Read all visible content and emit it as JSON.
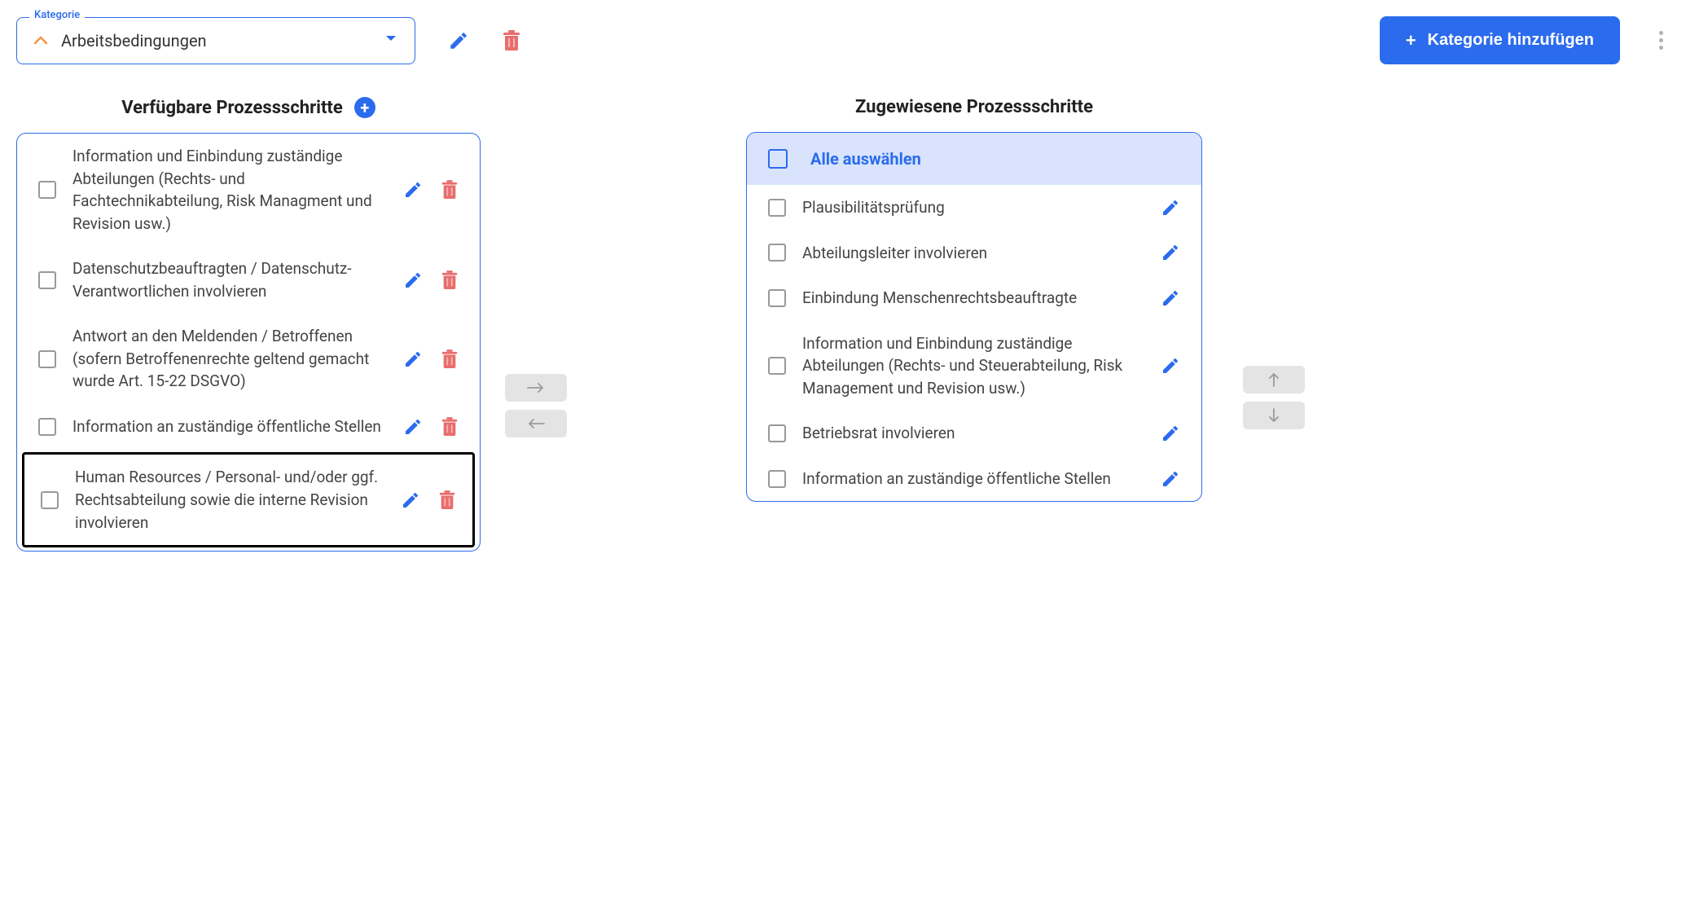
{
  "category": {
    "legend": "Kategorie",
    "value": "Arbeitsbedingungen"
  },
  "add_category_label": "Kategorie hinzufügen",
  "available": {
    "title": "Verfügbare Prozessschritte",
    "items": [
      {
        "label": "Information und Einbindung zuständige Abteilungen (Rechts- und Fachtechnikabteilung, Risk Managment und Revision usw.)",
        "highlighted": false
      },
      {
        "label": "Datenschutzbeauftragten / Datenschutz-Verantwortlichen involvieren",
        "highlighted": false
      },
      {
        "label": "Antwort an den Meldenden / Betroffenen (sofern Betroffenenrechte geltend gemacht wurde Art. 15-22 DSGVO)",
        "highlighted": false
      },
      {
        "label": "Information an zuständige öffentliche Stellen",
        "highlighted": false
      },
      {
        "label": "Human Resources / Personal- und/oder ggf. Rechtsabteilung sowie die interne Revision involvieren",
        "highlighted": true
      }
    ]
  },
  "assigned": {
    "title": "Zugewiesene Prozessschritte",
    "select_all": "Alle auswählen",
    "items": [
      {
        "label": "Plausibilitätsprüfung"
      },
      {
        "label": "Abteilungsleiter involvieren"
      },
      {
        "label": "Einbindung Menschenrechtsbeauftragte"
      },
      {
        "label": "Information und Einbindung zuständige Abteilungen (Rechts- und Steuerabteilung, Risk Management und Revision usw.)"
      },
      {
        "label": "Betriebsrat involvieren"
      },
      {
        "label": "Information an zuständige öffentliche Stellen"
      }
    ]
  }
}
